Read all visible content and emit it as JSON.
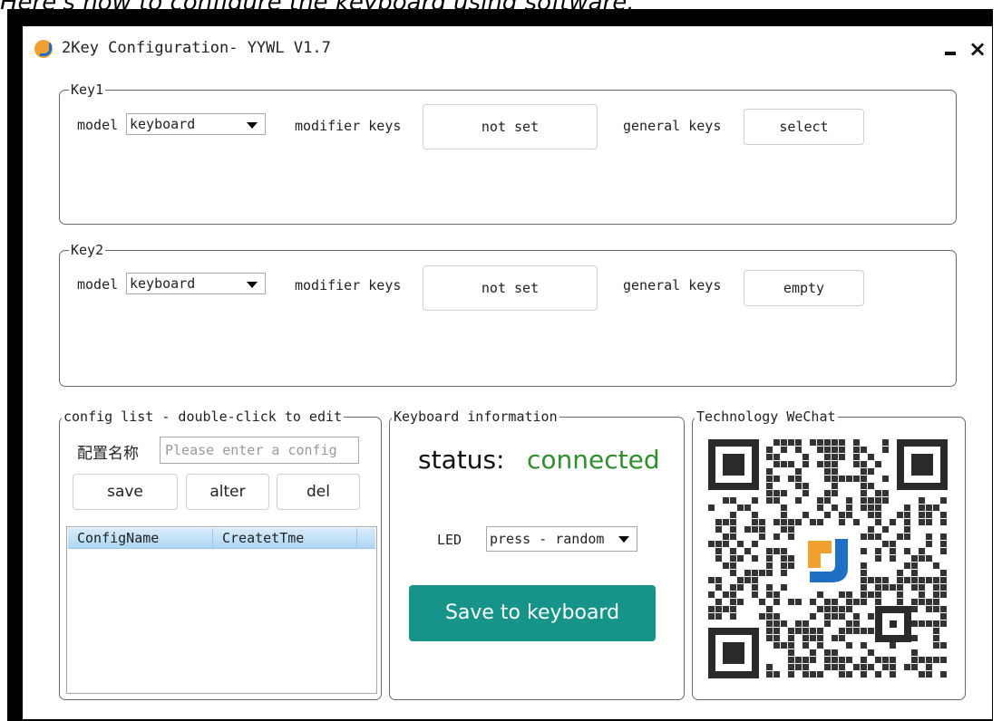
{
  "caption": "Here's how to configure the keyboard using software.",
  "window": {
    "title": "2Key Configuration- YYWL V1.7",
    "minimize_label": "",
    "close_label": "×"
  },
  "key1": {
    "legend": "Key1",
    "model_label": "model",
    "model_value": "keyboard",
    "modifier_label": "modifier keys",
    "modifier_value": "not set",
    "general_label": "general keys",
    "general_value": "select"
  },
  "key2": {
    "legend": "Key2",
    "model_label": "model",
    "model_value": "keyboard",
    "modifier_label": "modifier keys",
    "modifier_value": "not set",
    "general_label": "general keys",
    "general_value": "empty"
  },
  "config": {
    "legend": "config list - double-click to edit",
    "name_label": "配置名称",
    "name_placeholder": "Please enter a config",
    "save_label": "save",
    "alter_label": "alter",
    "del_label": "del",
    "columns": [
      "ConfigName",
      "CreatetTme"
    ]
  },
  "keyboard_info": {
    "legend": "Keyboard information",
    "status_label": "status:",
    "status_value": "connected",
    "led_label": "LED",
    "led_value": "press - random",
    "save_button": "Save to keyboard"
  },
  "wechat": {
    "legend": "Technology WeChat"
  },
  "colors": {
    "status_connected": "#2f8f2f",
    "save_button_bg": "#16948a",
    "table_header": "#aed7f4"
  },
  "icons": {
    "app": "app-logo-icon",
    "dropdown": "chevron-down-icon"
  }
}
